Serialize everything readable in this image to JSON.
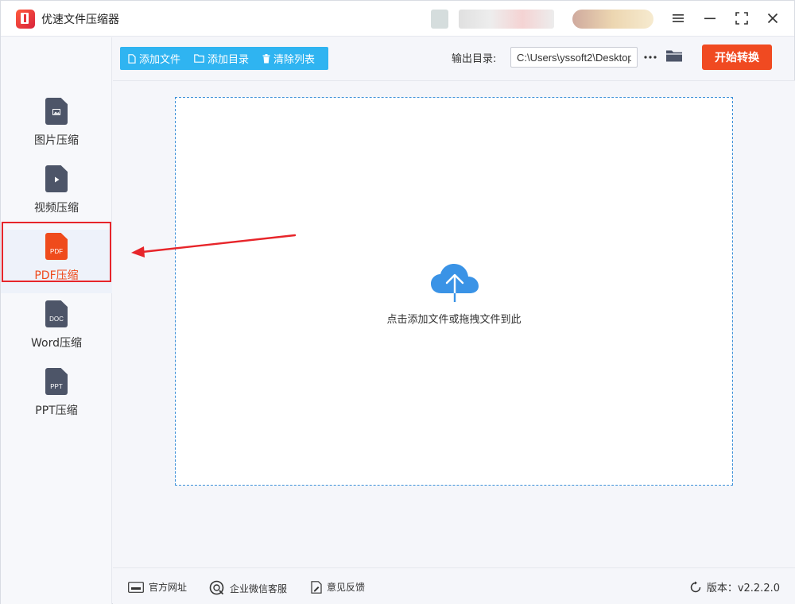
{
  "app": {
    "title": "优速文件压缩器"
  },
  "colors": {
    "accent": "#2fb4f1",
    "primary_action": "#f04a21",
    "active_nav": "#ef4b1c",
    "annotation": "#e7252a",
    "dropzone_border": "#3a8fd8",
    "cloud": "#3a93e6"
  },
  "sidebar": {
    "items": [
      {
        "label": "图片压缩",
        "icon": "image-file-icon",
        "badge": "",
        "active": false
      },
      {
        "label": "视频压缩",
        "icon": "video-file-icon",
        "badge": "",
        "active": false
      },
      {
        "label": "PDF压缩",
        "icon": "pdf-file-icon",
        "badge": "PDF",
        "active": true
      },
      {
        "label": "Word压缩",
        "icon": "doc-file-icon",
        "badge": "DOC",
        "active": false
      },
      {
        "label": "PPT压缩",
        "icon": "ppt-file-icon",
        "badge": "PPT",
        "active": false
      }
    ]
  },
  "toolbar": {
    "add_file": "添加文件",
    "add_folder": "添加目录",
    "clear_list": "清除列表",
    "output_label": "输出目录:",
    "output_path": "C:\\Users\\yssoft2\\Desktop",
    "start_label": "开始转换"
  },
  "dropzone": {
    "hint": "点击添加文件或拖拽文件到此"
  },
  "footer": {
    "website": "官方网址",
    "wechat": "企业微信客服",
    "feedback": "意见反馈",
    "version": "版本：v2.2.2.0"
  }
}
